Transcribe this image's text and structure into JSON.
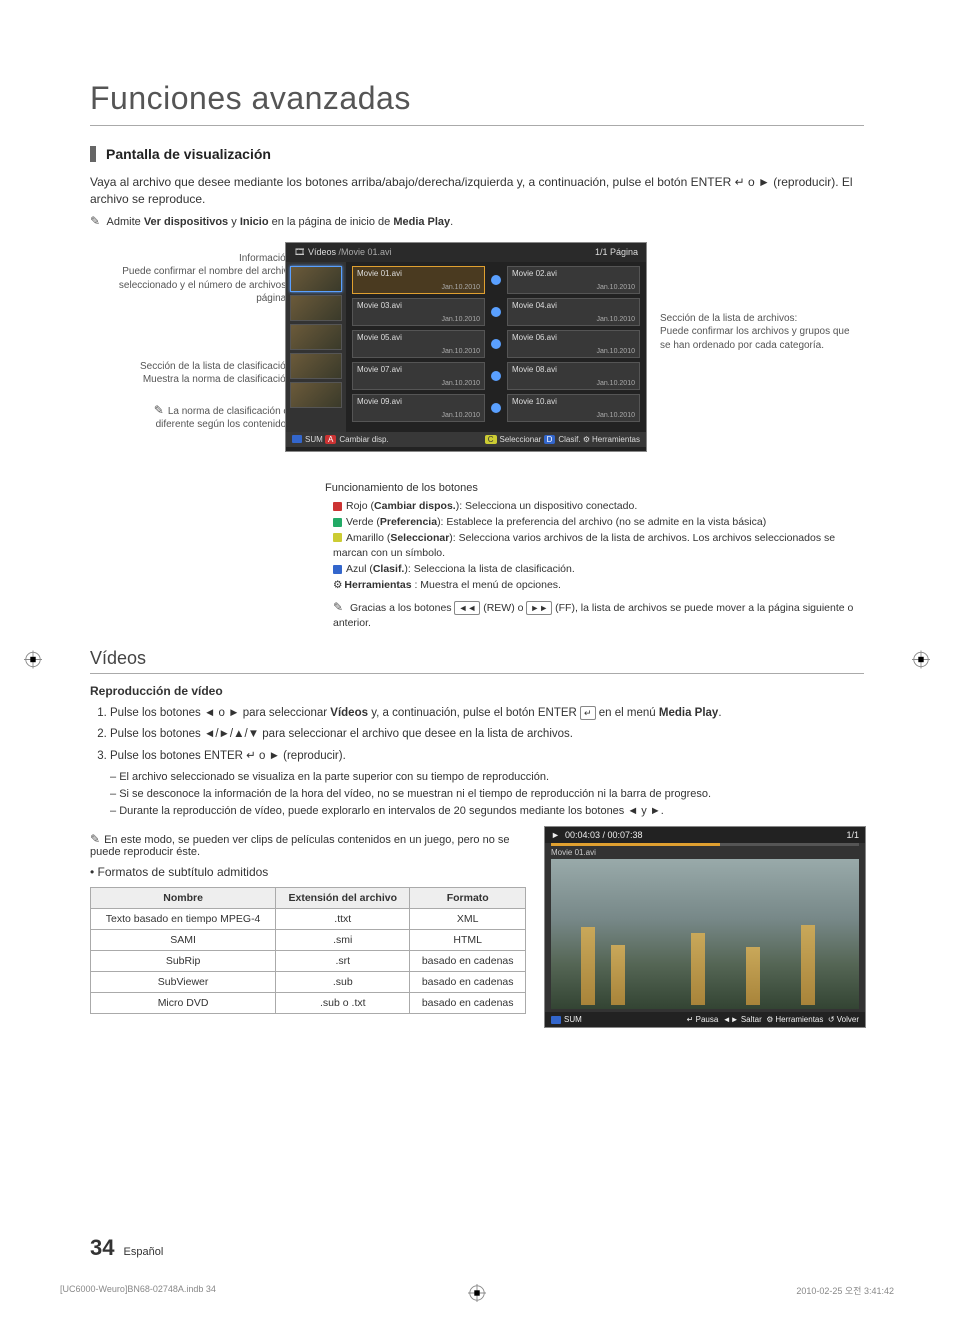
{
  "title": "Funciones avanzadas",
  "section1_header": "Pantalla de visualización",
  "intro_para": "Vaya al archivo que desee mediante los botones arriba/abajo/derecha/izquierda y, a continuación, pulse el botón ENTER ↵ o ► (reproducir). El archivo se reproduce.",
  "note_admite_pre": "Admite ",
  "note_admite_b1": "Ver dispositivos",
  "note_admite_mid": " y ",
  "note_admite_b2": "Inicio",
  "note_admite_post": " en la página de inicio de ",
  "note_admite_b3": "Media Play",
  "side_info_label": "Información:",
  "side_info_text": "Puede confirmar el nombre del archivo seleccionado y el número de archivos y páginas.",
  "side_clasif_label": "Sección de la lista de clasificación: Muestra la norma de clasificación.",
  "side_clasif_note": "La norma de clasificación es diferente según los contenidos.",
  "side_files_label": "Sección de la lista de archivos:",
  "side_files_text": "Puede confirmar los archivos y grupos que se han ordenado por cada categoría.",
  "media": {
    "tab": "Vídeos",
    "path": "/Movie 01.avi",
    "page": "1/1 Página",
    "files": [
      {
        "n": "Movie 01.avi",
        "d": "Jan.10.2010"
      },
      {
        "n": "Movie 02.avi",
        "d": "Jan.10.2010"
      },
      {
        "n": "Movie 03.avi",
        "d": "Jan.10.2010"
      },
      {
        "n": "Movie 04.avi",
        "d": "Jan.10.2010"
      },
      {
        "n": "Movie 05.avi",
        "d": "Jan.10.2010"
      },
      {
        "n": "Movie 06.avi",
        "d": "Jan.10.2010"
      },
      {
        "n": "Movie 07.avi",
        "d": "Jan.10.2010"
      },
      {
        "n": "Movie 08.avi",
        "d": "Jan.10.2010"
      },
      {
        "n": "Movie 09.avi",
        "d": "Jan.10.2010"
      },
      {
        "n": "Movie 10.avi",
        "d": "Jan.10.2010"
      }
    ],
    "footer_sum": "SUM",
    "footer_a": "Cambiar disp.",
    "footer_c": "Seleccionar",
    "footer_d": "Clasif.",
    "footer_tools": "Herramientas"
  },
  "btn_ops_header": "Funcionamiento de los botones",
  "btn_a_pre": "Rojo (",
  "btn_a_b": "Cambiar dispos.",
  "btn_a_post": "): Selecciona un dispositivo conectado.",
  "btn_b_pre": "Verde (",
  "btn_b_b": "Preferencia",
  "btn_b_post": "): Establece la preferencia del archivo (no se admite en la vista básica)",
  "btn_c_pre": "Amarillo (",
  "btn_c_b": "Seleccionar",
  "btn_c_post": "): Selecciona varios archivos de la lista de archivos. Los archivos seleccionados se marcan con un símbolo.",
  "btn_d_pre": "Azul (",
  "btn_d_b": "Clasif.",
  "btn_d_post": "): Selecciona la lista de clasificación.",
  "btn_t_b": "Herramientas",
  "btn_t_post": " : Muestra el menú de opciones.",
  "btn_note_pre": "Gracias a los botones ",
  "btn_note_mid1": " (REW) o ",
  "btn_note_mid2": " (FF), la lista de archivos se puede mover a la página siguiente o anterior.",
  "videos_h2": "Vídeos",
  "repro_header": "Reproducción de vídeo",
  "step1_pre": "Pulse los botones ◄ o ► para seleccionar ",
  "step1_b1": "Vídeos",
  "step1_mid": " y, a continuación, pulse el botón ENTER ",
  "step1_post": " en el menú ",
  "step1_b2": "Media Play",
  "step2": "Pulse los botones ◄/►/▲/▼ para seleccionar el archivo que desee en la lista de archivos.",
  "step3": "Pulse los botones ENTER ↵ o ► (reproducir).",
  "dash1": "El archivo seleccionado se visualiza en la parte superior con su tiempo de reproducción.",
  "dash2": "Si se desconoce la información de la hora del vídeo, no se muestran ni el tiempo de reproducción ni la barra de progreso.",
  "dash3": "Durante la reproducción de vídeo, puede explorarlo en intervalos de 20 segundos mediante los botones ◄ y ►.",
  "clip_note": "En este modo, se pueden ver clips de películas contenidos en un juego, pero no se puede reproducir éste.",
  "formats_bullet": "Formatos de subtítulo admitidos",
  "table": {
    "h1": "Nombre",
    "h2": "Extensión del archivo",
    "h3": "Formato",
    "rows": [
      {
        "c1": "Texto basado en tiempo MPEG-4",
        "c2": ".ttxt",
        "c3": "XML"
      },
      {
        "c1": "SAMI",
        "c2": ".smi",
        "c3": "HTML"
      },
      {
        "c1": "SubRip",
        "c2": ".srt",
        "c3": "basado en cadenas"
      },
      {
        "c1": "SubViewer",
        "c2": ".sub",
        "c3": "basado en cadenas"
      },
      {
        "c1": "Micro DVD",
        "c2": ".sub o .txt",
        "c3": "basado en cadenas"
      }
    ]
  },
  "player": {
    "time": "00:04:03 / 00:07:38",
    "count": "1/1",
    "path": "Movie 01.avi",
    "sum": "SUM",
    "pause": "Pausa",
    "skip": "Saltar",
    "tools": "Herramientas",
    "back": "Volver"
  },
  "page_num": "34",
  "page_lang": "Español",
  "print_left": "[UC6000-Weuro]BN68-02748A.indb   34",
  "print_right": "2010-02-25   오전 3:41:42"
}
